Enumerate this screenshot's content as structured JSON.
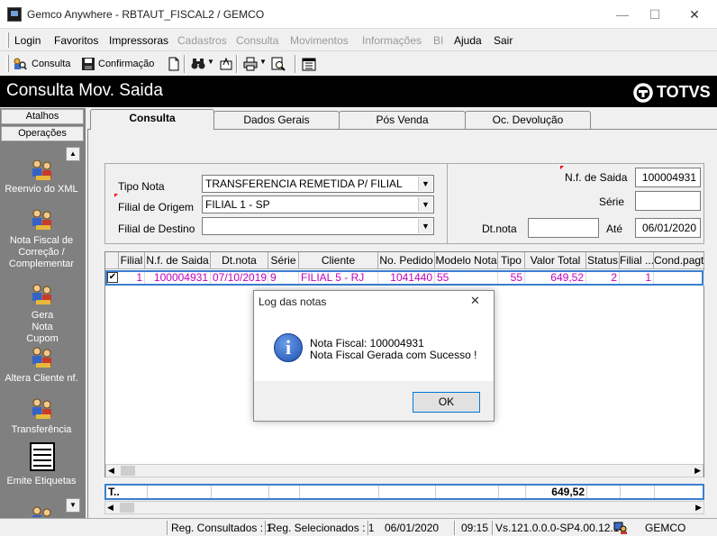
{
  "window": {
    "title": "Gemco Anywhere - RBTAUT_FISCAL2 / GEMCO",
    "minimize": "—",
    "maximize": "☐",
    "close": "✕"
  },
  "menu": [
    {
      "label": "Login",
      "enabled": true
    },
    {
      "label": "Favoritos",
      "enabled": true
    },
    {
      "label": "Impressoras",
      "enabled": true
    },
    {
      "label": "Cadastros",
      "enabled": false
    },
    {
      "label": "Consulta",
      "enabled": false
    },
    {
      "label": "Movimentos",
      "enabled": false
    },
    {
      "label": "Informações",
      "enabled": false
    },
    {
      "label": "BI",
      "enabled": false
    },
    {
      "label": "Ajuda",
      "enabled": true
    },
    {
      "label": "Sair",
      "enabled": true
    }
  ],
  "toolbar": {
    "consulta_label": "Consulta",
    "confirmacao_label": "Confirmação"
  },
  "header": {
    "title": "Consulta Mov. Saida",
    "brand": "TOTVS"
  },
  "left_pane": {
    "tabs": [
      "Atalhos",
      "Operações"
    ],
    "items": [
      {
        "label": "Reenvio do XML",
        "icon": "users-icon"
      },
      {
        "label": "Nota Fiscal de Correção / Complementar",
        "icon": "users-icon"
      },
      {
        "label": "Gera Nota Cupom",
        "icon": "users-icon"
      },
      {
        "label": "Altera Cliente nf.",
        "icon": "users-icon"
      },
      {
        "label": "Transferência",
        "icon": "users-icon"
      },
      {
        "label": "Emite Etiquetas",
        "icon": "document-icon"
      }
    ]
  },
  "tabs": [
    {
      "label": "Consulta",
      "active": true
    },
    {
      "label": "Dados Gerais",
      "active": false
    },
    {
      "label": "Pós Venda",
      "active": false
    },
    {
      "label": "Oc. Devolução",
      "active": false
    }
  ],
  "filters": {
    "tipo_nota_label": "Tipo Nota",
    "tipo_nota_value": "TRANSFERENCIA REMETIDA P/ FILIAL",
    "filial_origem_label": "Filial de Origem",
    "filial_origem_value": "FILIAL 1 - SP",
    "filial_destino_label": "Filial de Destino",
    "filial_destino_value": "",
    "nf_saida_label": "N.f. de Saida",
    "nf_saida_value": "100004931",
    "serie_label": "Série",
    "serie_value": "",
    "dtnota_label": "Dt.nota",
    "dtnota_from": "",
    "ate_label": "Até",
    "dtnota_to": "06/01/2020"
  },
  "grid": {
    "columns": [
      "",
      "Filial",
      "N.f. de Saida",
      "Dt.nota",
      "Série",
      "Cliente",
      "No. Pedido",
      "Modelo Nota",
      "Tipo",
      "Valor Total",
      "Status",
      "Filial ...",
      "Cond.pagto"
    ],
    "rows": [
      {
        "checked": true,
        "filial": "1",
        "nf": "100004931",
        "dtnota": "07/10/2019",
        "serie": "9",
        "cliente": "FILIAL 5 - RJ",
        "pedido": "1041440",
        "modelo": "55",
        "tipo": "55",
        "valor": "649,52",
        "status": "2",
        "filial2": "1",
        "cond": ""
      }
    ],
    "totals": {
      "label": "T..",
      "valor": "649,52"
    }
  },
  "dialog": {
    "title": "Log das notas",
    "line1": "Nota Fiscal: 100004931",
    "line2": "Nota Fiscal Gerada com Sucesso !",
    "ok": "OK",
    "close": "✕"
  },
  "statusbar": {
    "consultados": "Reg. Consultados : 1",
    "selecionados": "Reg. Selecionados : 1",
    "date": "06/01/2020",
    "time": "09:15",
    "version": "Vs.121.0.0.0-SP4.00.12.1",
    "company": "GEMCO"
  },
  "colors": {
    "row_text": "#c000c0",
    "selection_border": "#3a7fd0",
    "header_bg": "#000000"
  }
}
